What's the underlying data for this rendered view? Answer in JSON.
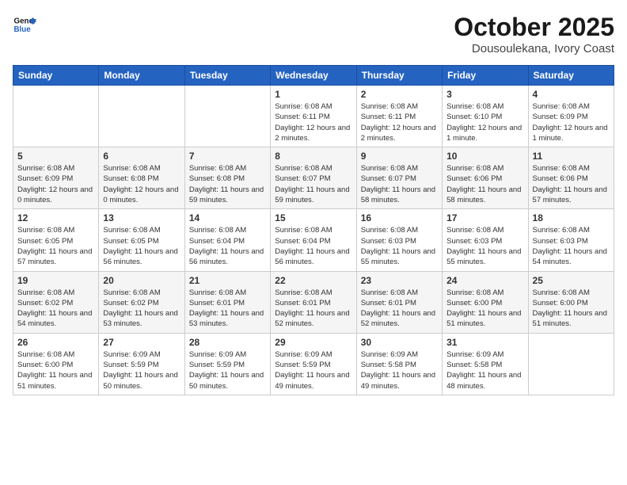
{
  "header": {
    "logo_line1": "General",
    "logo_line2": "Blue",
    "month": "October 2025",
    "location": "Dousoulekana, Ivory Coast"
  },
  "days_of_week": [
    "Sunday",
    "Monday",
    "Tuesday",
    "Wednesday",
    "Thursday",
    "Friday",
    "Saturday"
  ],
  "weeks": [
    [
      {
        "day": "",
        "info": ""
      },
      {
        "day": "",
        "info": ""
      },
      {
        "day": "",
        "info": ""
      },
      {
        "day": "1",
        "info": "Sunrise: 6:08 AM\nSunset: 6:11 PM\nDaylight: 12 hours and 2 minutes."
      },
      {
        "day": "2",
        "info": "Sunrise: 6:08 AM\nSunset: 6:11 PM\nDaylight: 12 hours and 2 minutes."
      },
      {
        "day": "3",
        "info": "Sunrise: 6:08 AM\nSunset: 6:10 PM\nDaylight: 12 hours and 1 minute."
      },
      {
        "day": "4",
        "info": "Sunrise: 6:08 AM\nSunset: 6:09 PM\nDaylight: 12 hours and 1 minute."
      }
    ],
    [
      {
        "day": "5",
        "info": "Sunrise: 6:08 AM\nSunset: 6:09 PM\nDaylight: 12 hours and 0 minutes."
      },
      {
        "day": "6",
        "info": "Sunrise: 6:08 AM\nSunset: 6:08 PM\nDaylight: 12 hours and 0 minutes."
      },
      {
        "day": "7",
        "info": "Sunrise: 6:08 AM\nSunset: 6:08 PM\nDaylight: 11 hours and 59 minutes."
      },
      {
        "day": "8",
        "info": "Sunrise: 6:08 AM\nSunset: 6:07 PM\nDaylight: 11 hours and 59 minutes."
      },
      {
        "day": "9",
        "info": "Sunrise: 6:08 AM\nSunset: 6:07 PM\nDaylight: 11 hours and 58 minutes."
      },
      {
        "day": "10",
        "info": "Sunrise: 6:08 AM\nSunset: 6:06 PM\nDaylight: 11 hours and 58 minutes."
      },
      {
        "day": "11",
        "info": "Sunrise: 6:08 AM\nSunset: 6:06 PM\nDaylight: 11 hours and 57 minutes."
      }
    ],
    [
      {
        "day": "12",
        "info": "Sunrise: 6:08 AM\nSunset: 6:05 PM\nDaylight: 11 hours and 57 minutes."
      },
      {
        "day": "13",
        "info": "Sunrise: 6:08 AM\nSunset: 6:05 PM\nDaylight: 11 hours and 56 minutes."
      },
      {
        "day": "14",
        "info": "Sunrise: 6:08 AM\nSunset: 6:04 PM\nDaylight: 11 hours and 56 minutes."
      },
      {
        "day": "15",
        "info": "Sunrise: 6:08 AM\nSunset: 6:04 PM\nDaylight: 11 hours and 56 minutes."
      },
      {
        "day": "16",
        "info": "Sunrise: 6:08 AM\nSunset: 6:03 PM\nDaylight: 11 hours and 55 minutes."
      },
      {
        "day": "17",
        "info": "Sunrise: 6:08 AM\nSunset: 6:03 PM\nDaylight: 11 hours and 55 minutes."
      },
      {
        "day": "18",
        "info": "Sunrise: 6:08 AM\nSunset: 6:03 PM\nDaylight: 11 hours and 54 minutes."
      }
    ],
    [
      {
        "day": "19",
        "info": "Sunrise: 6:08 AM\nSunset: 6:02 PM\nDaylight: 11 hours and 54 minutes."
      },
      {
        "day": "20",
        "info": "Sunrise: 6:08 AM\nSunset: 6:02 PM\nDaylight: 11 hours and 53 minutes."
      },
      {
        "day": "21",
        "info": "Sunrise: 6:08 AM\nSunset: 6:01 PM\nDaylight: 11 hours and 53 minutes."
      },
      {
        "day": "22",
        "info": "Sunrise: 6:08 AM\nSunset: 6:01 PM\nDaylight: 11 hours and 52 minutes."
      },
      {
        "day": "23",
        "info": "Sunrise: 6:08 AM\nSunset: 6:01 PM\nDaylight: 11 hours and 52 minutes."
      },
      {
        "day": "24",
        "info": "Sunrise: 6:08 AM\nSunset: 6:00 PM\nDaylight: 11 hours and 51 minutes."
      },
      {
        "day": "25",
        "info": "Sunrise: 6:08 AM\nSunset: 6:00 PM\nDaylight: 11 hours and 51 minutes."
      }
    ],
    [
      {
        "day": "26",
        "info": "Sunrise: 6:08 AM\nSunset: 6:00 PM\nDaylight: 11 hours and 51 minutes."
      },
      {
        "day": "27",
        "info": "Sunrise: 6:09 AM\nSunset: 5:59 PM\nDaylight: 11 hours and 50 minutes."
      },
      {
        "day": "28",
        "info": "Sunrise: 6:09 AM\nSunset: 5:59 PM\nDaylight: 11 hours and 50 minutes."
      },
      {
        "day": "29",
        "info": "Sunrise: 6:09 AM\nSunset: 5:59 PM\nDaylight: 11 hours and 49 minutes."
      },
      {
        "day": "30",
        "info": "Sunrise: 6:09 AM\nSunset: 5:58 PM\nDaylight: 11 hours and 49 minutes."
      },
      {
        "day": "31",
        "info": "Sunrise: 6:09 AM\nSunset: 5:58 PM\nDaylight: 11 hours and 48 minutes."
      },
      {
        "day": "",
        "info": ""
      }
    ]
  ]
}
